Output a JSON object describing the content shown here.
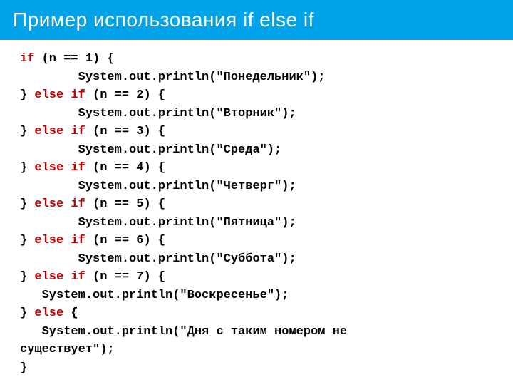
{
  "header": {
    "title": "Пример использования if else if"
  },
  "code": {
    "lines": [
      {
        "segments": [
          {
            "t": "if",
            "kw": true
          },
          {
            "t": " (n == 1) {"
          }
        ]
      },
      {
        "segments": [
          {
            "t": "        System.out.println(\"Понедельник\");"
          }
        ]
      },
      {
        "segments": [
          {
            "t": "} "
          },
          {
            "t": "else if",
            "kw": true
          },
          {
            "t": " (n == 2) {"
          }
        ]
      },
      {
        "segments": [
          {
            "t": "        System.out.println(\"Вторник\");"
          }
        ]
      },
      {
        "segments": [
          {
            "t": "} "
          },
          {
            "t": "else if",
            "kw": true
          },
          {
            "t": " (n == 3) {"
          }
        ]
      },
      {
        "segments": [
          {
            "t": "        System.out.println(\"Среда\");"
          }
        ]
      },
      {
        "segments": [
          {
            "t": "} "
          },
          {
            "t": "else if",
            "kw": true
          },
          {
            "t": " (n == 4) {"
          }
        ]
      },
      {
        "segments": [
          {
            "t": "        System.out.println(\"Четверг\");"
          }
        ]
      },
      {
        "segments": [
          {
            "t": "} "
          },
          {
            "t": "else if",
            "kw": true
          },
          {
            "t": " (n == 5) {"
          }
        ]
      },
      {
        "segments": [
          {
            "t": "        System.out.println(\"Пятница\");"
          }
        ]
      },
      {
        "segments": [
          {
            "t": "} "
          },
          {
            "t": "else if",
            "kw": true
          },
          {
            "t": " (n == 6) {"
          }
        ]
      },
      {
        "segments": [
          {
            "t": "        System.out.println(\"Суббота\");"
          }
        ]
      },
      {
        "segments": [
          {
            "t": "} "
          },
          {
            "t": "else if",
            "kw": true
          },
          {
            "t": " (n == 7) {"
          }
        ]
      },
      {
        "segments": [
          {
            "t": "   System.out.println(\"Воскресенье\");"
          }
        ]
      },
      {
        "segments": [
          {
            "t": "} "
          },
          {
            "t": "else",
            "kw": true
          },
          {
            "t": " {"
          }
        ]
      },
      {
        "segments": [
          {
            "t": "   System.out.println(\"Дня с таким номером не"
          }
        ]
      },
      {
        "segments": [
          {
            "t": "существует\");"
          }
        ]
      },
      {
        "segments": [
          {
            "t": "}"
          }
        ]
      }
    ]
  }
}
